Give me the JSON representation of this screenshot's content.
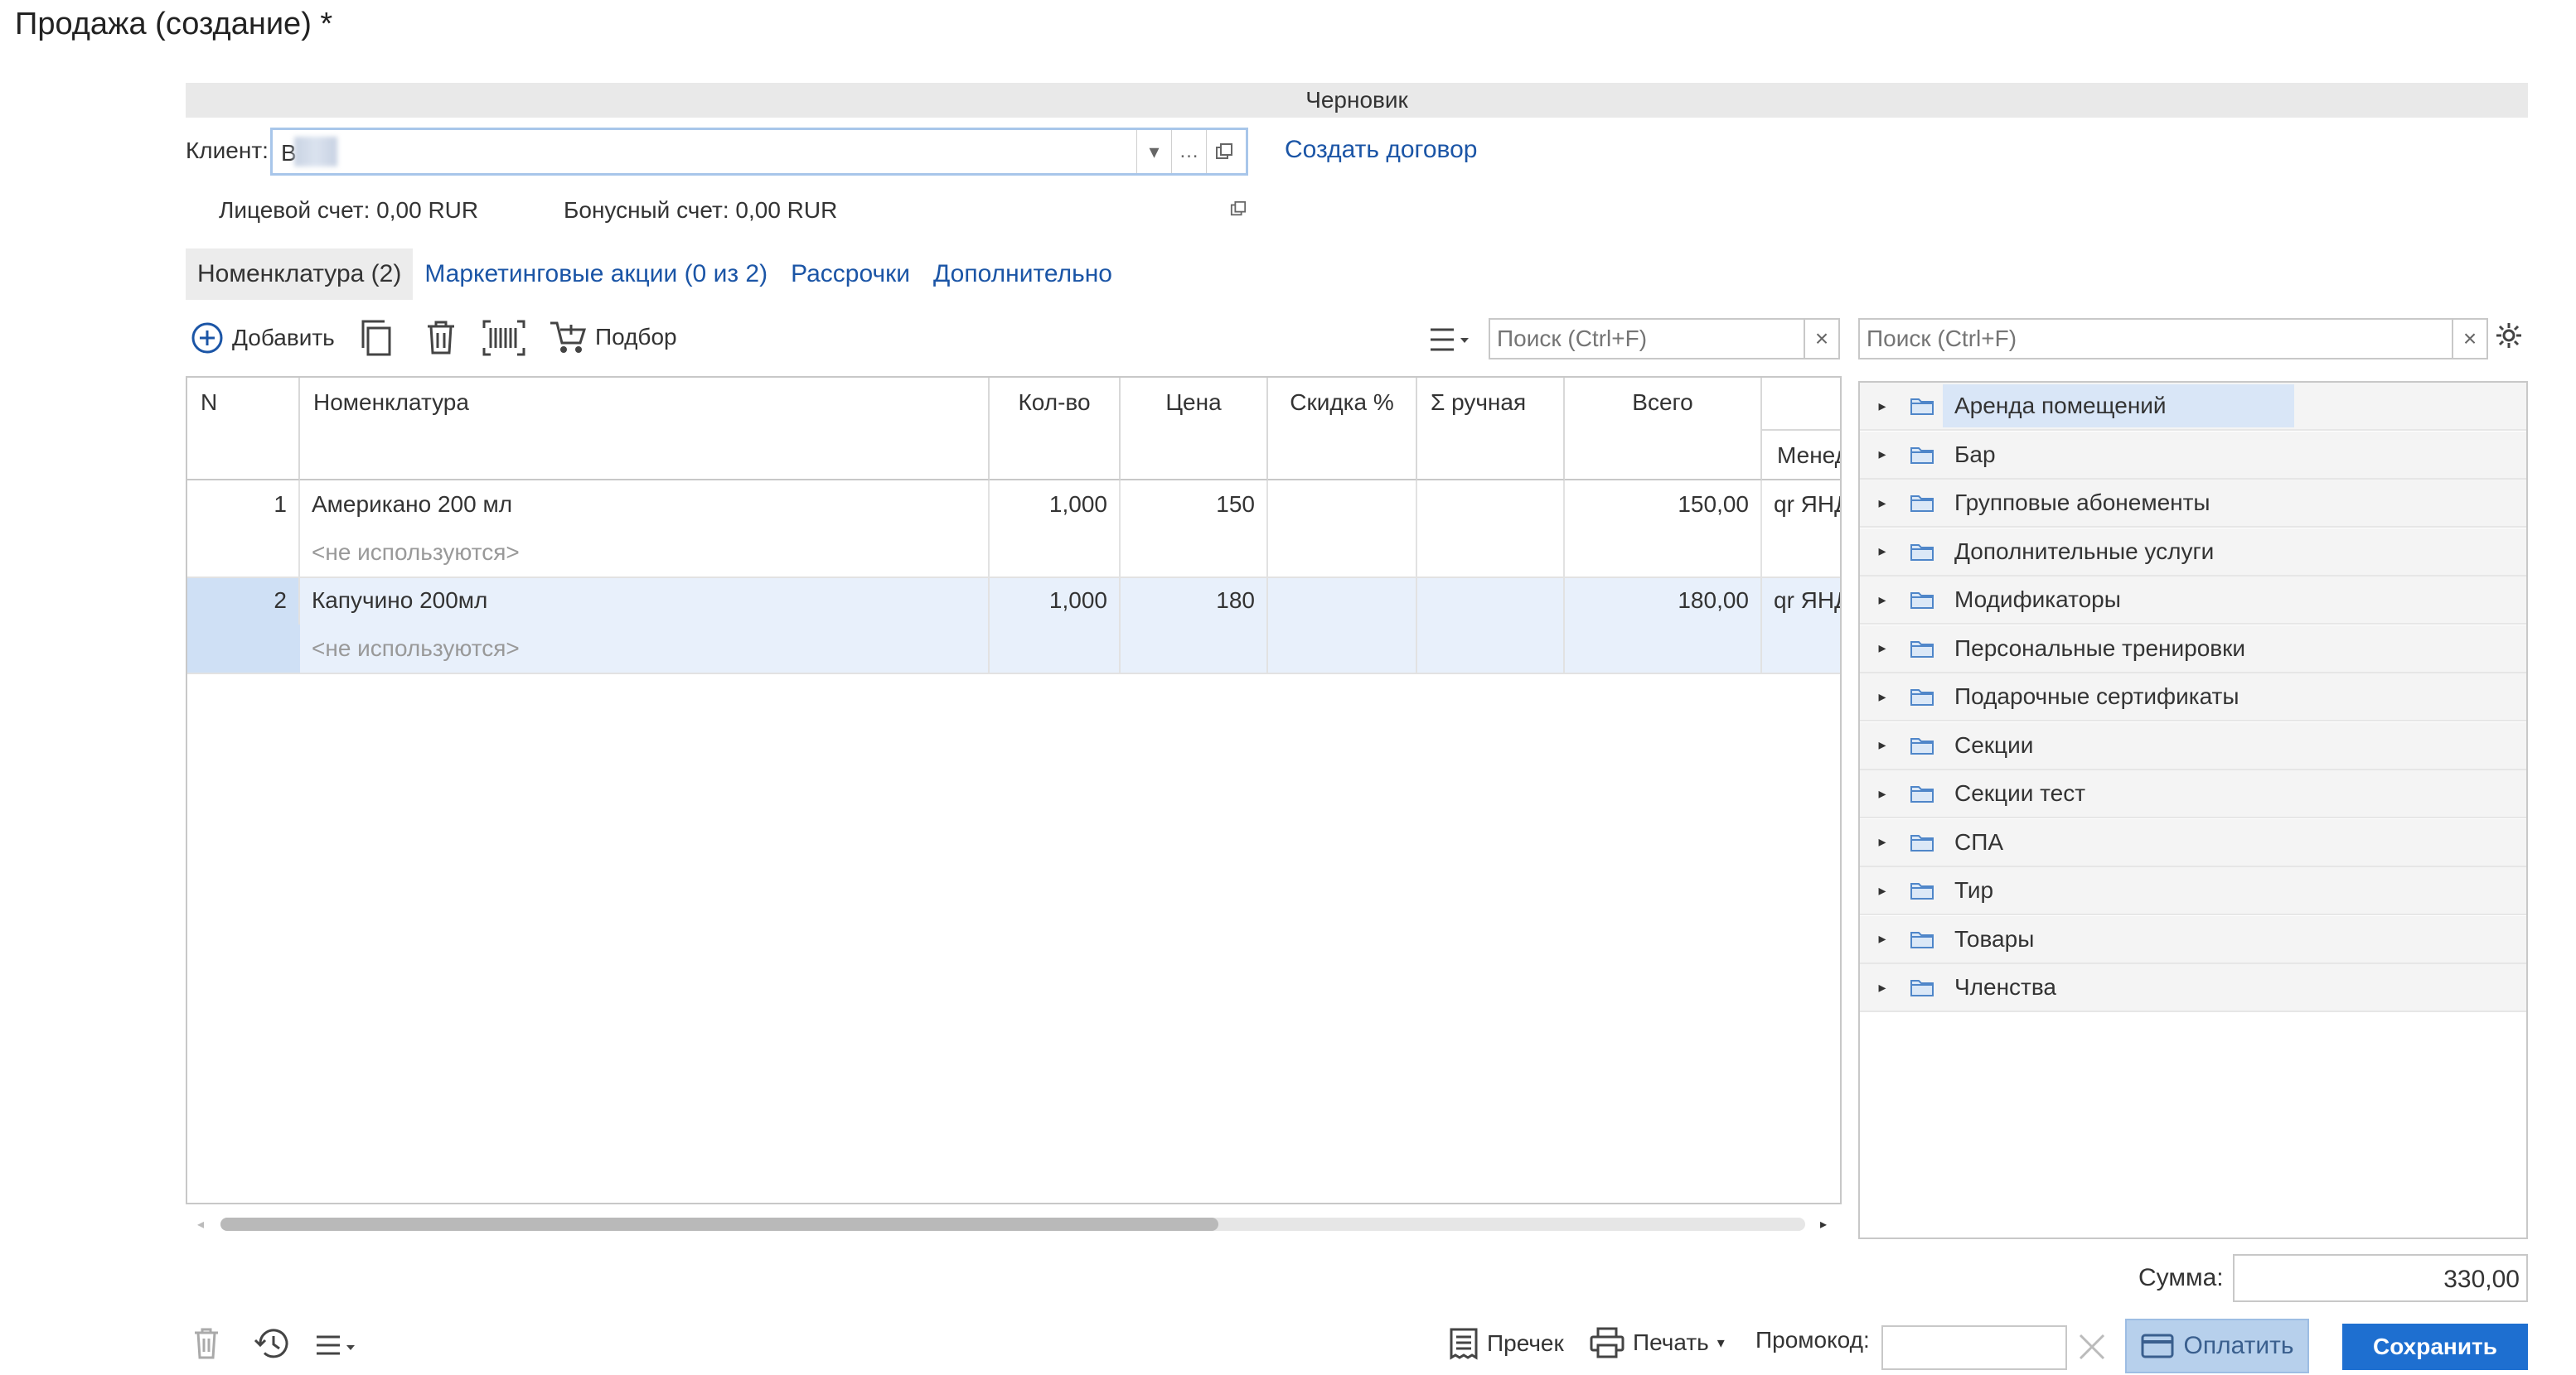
{
  "window": {
    "title": "Продажа (создание) *"
  },
  "status": "Черновик",
  "client": {
    "label": "Клиент:",
    "value": "В",
    "create_contract": "Создать договор"
  },
  "accounts": {
    "personal": "Лицевой счет: 0,00 RUR",
    "bonus": "Бонусный счет: 0,00 RUR"
  },
  "tabs": [
    "Номенклатура (2)",
    "Маркетинговые акции (0 из 2)",
    "Рассрочки",
    "Дополнительно"
  ],
  "toolbar": {
    "add": "Добавить",
    "pick": "Подбор"
  },
  "search": {
    "placeholder": "Поиск (Ctrl+F)",
    "clear": "×"
  },
  "table": {
    "columns": [
      "N",
      "Номенклатура",
      "Кол-во",
      "Цена",
      "Скидка %",
      "Σ ручная",
      "Всего",
      "Менед"
    ],
    "rows": [
      {
        "n": "1",
        "name": "Американо 200 мл",
        "sub": "<не используются>",
        "qty": "1,000",
        "price": "150",
        "discount": "",
        "manual": "",
        "total": "150,00",
        "manager": "qr ЯНД"
      },
      {
        "n": "2",
        "name": "Капучино 200мл",
        "sub": "<не используются>",
        "qty": "1,000",
        "price": "180",
        "discount": "",
        "manual": "",
        "total": "180,00",
        "manager": "qr ЯНД"
      }
    ]
  },
  "tree": {
    "items": [
      "Аренда помещений",
      "Бар",
      "Групповые абонементы",
      "Дополнительные услуги",
      "Модификаторы",
      "Персональные тренировки",
      "Подарочные сертификаты",
      "Секции",
      "Секции тест",
      "СПА",
      "Тир",
      "Товары",
      "Членства"
    ]
  },
  "summary": {
    "label": "Сумма:",
    "value": "330,00"
  },
  "bottom": {
    "precheck": "Пречек",
    "print": "Печать",
    "promo_label": "Промокод:",
    "pay": "Оплатить",
    "save": "Сохранить"
  },
  "colors": {
    "accent": "#1e6fd0",
    "link": "#1b55a6",
    "selection": "#e8f0fb",
    "pay_bg": "#b7d0ec"
  }
}
